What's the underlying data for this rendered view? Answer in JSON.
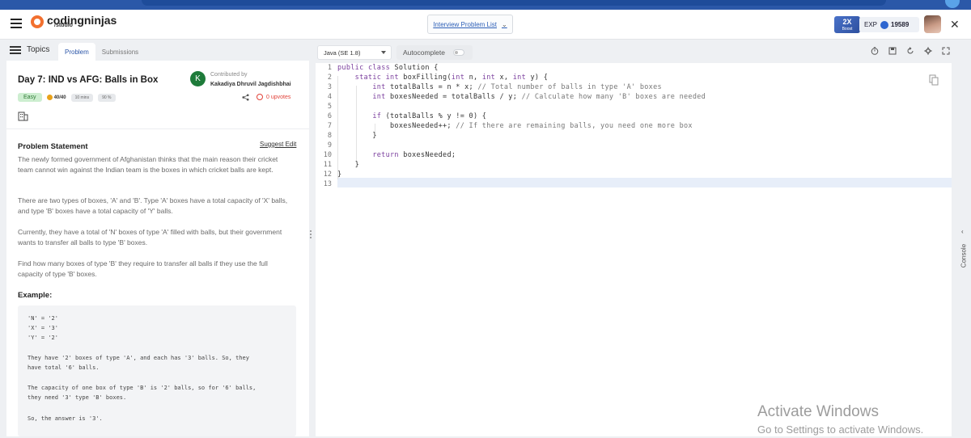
{
  "brand": {
    "name": "codingninjas",
    "sub": "/studio"
  },
  "header": {
    "problem_list_label": "Interview Problem List",
    "boost": {
      "multiplier": "2X",
      "label": "Boost"
    },
    "exp_label": "EXP",
    "exp_value": "19589"
  },
  "left": {
    "topics_label": "Topics",
    "tabs": [
      {
        "label": "Problem",
        "active": true
      },
      {
        "label": "Submissions",
        "active": false
      }
    ],
    "title": "Day 7: IND vs AFG: Balls in Box",
    "contributor": {
      "initial": "K",
      "label": "Contributed by",
      "name": "Kakadiya Dhruvil Jagdishbhai"
    },
    "difficulty": "Easy",
    "score": "40/40",
    "time": "10 mins",
    "accuracy": "90 %",
    "upvotes": "0 upvotes",
    "statement_heading": "Problem Statement",
    "suggest_edit": "Suggest Edit",
    "paragraphs": [
      "The newly formed government of Afghanistan thinks that the main reason their cricket team cannot win against the Indian team is the boxes in which cricket balls are kept.",
      "There are two types of boxes, 'A' and 'B'. Type 'A' boxes have a total capacity of 'X' balls, and type 'B' boxes have a total capacity of 'Y' balls.",
      "Currently, they have a total of 'N' boxes of type 'A' filled with balls, but their government wants to transfer all balls to type 'B' boxes.",
      "Find how many boxes of type 'B' they require to transfer all balls if they use the full capacity of type 'B' boxes."
    ],
    "example_heading": "Example:",
    "example_lines": [
      "'N' = '2'",
      "'X' = '3'",
      "'Y' = '2'",
      "",
      "They have '2' boxes of type 'A', and each has '3' balls. So, they",
      "have total '6' balls.",
      "",
      "The capacity of one box of type 'B' is '2' balls, so for '6' balls,",
      "they need '3' type 'B' boxes.",
      "",
      "So, the answer is '3'."
    ]
  },
  "editor": {
    "language": "Java (SE 1.8)",
    "autocomplete_label": "Autocomplete",
    "line_numbers": [
      "1",
      "2",
      "3",
      "4",
      "5",
      "6",
      "7",
      "8",
      "9",
      "10",
      "11",
      "12",
      "13"
    ],
    "code_lines": [
      "public class Solution {",
      "    static int boxFilling(int n, int x, int y) {",
      "        int totalBalls = n * x; // Total number of balls in type 'A' boxes",
      "        int boxesNeeded = totalBalls / y; // Calculate how many 'B' boxes are needed",
      "",
      "        if (totalBalls % y != 0) {",
      "            boxesNeeded++; // If there are remaining balls, you need one more box",
      "        }",
      "",
      "        return boxesNeeded;",
      "    }",
      "}",
      ""
    ]
  },
  "console_label": "Console",
  "watermark": {
    "line1": "Activate Windows",
    "line2": "Go to Settings to activate Windows."
  }
}
